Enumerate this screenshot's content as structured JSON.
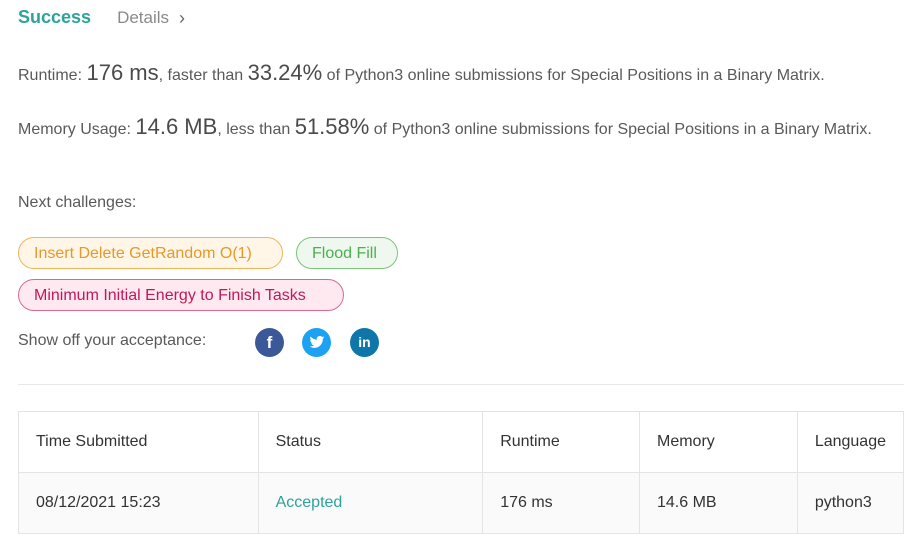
{
  "header": {
    "status": "Success",
    "details_label": "Details",
    "details_chevron": "›"
  },
  "runtime_stat": {
    "label": "Runtime:",
    "value": "176 ms",
    "middle": ", faster than",
    "percent": "33.24%",
    "suffix": "of Python3 online submissions for Special Positions in a Binary Matrix."
  },
  "memory_stat": {
    "label": "Memory Usage:",
    "value": "14.6 MB",
    "middle": ", less than",
    "percent": "51.58%",
    "suffix": "of Python3 online submissions for Special Positions in a Binary Matrix."
  },
  "next_challenges": {
    "label": "Next challenges:",
    "items": [
      "Insert Delete GetRandom O(1)",
      "Flood Fill",
      "Minimum Initial Energy to Finish Tasks"
    ]
  },
  "share": {
    "label": "Show off your acceptance:",
    "icons": [
      "facebook-icon",
      "twitter-icon",
      "linkedin-icon"
    ],
    "fb_glyph": "f",
    "li_glyph": "in"
  },
  "table": {
    "headers": [
      "Time Submitted",
      "Status",
      "Runtime",
      "Memory",
      "Language"
    ],
    "rows": [
      [
        "08/12/2021 15:23",
        "Accepted",
        "176 ms",
        "14.6 MB",
        "python3"
      ]
    ]
  },
  "colors": {
    "accent": "#2da39a",
    "orange": "#e49a2a",
    "green": "#4caf50",
    "pink": "#c2185b",
    "facebook": "#3b5998",
    "twitter": "#1da1f2",
    "linkedin": "#0e76a8"
  }
}
